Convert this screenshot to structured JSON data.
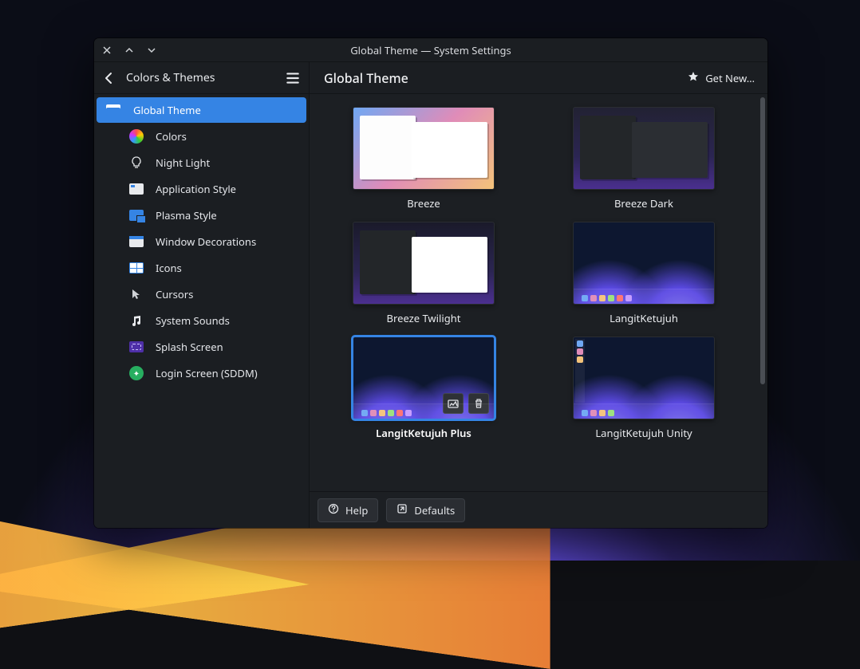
{
  "window": {
    "title": "Global Theme — System Settings"
  },
  "header": {
    "breadcrumb": "Colors & Themes",
    "page_title": "Global Theme",
    "get_new_label": "Get New…"
  },
  "sidebar": {
    "items": [
      {
        "id": "global-theme",
        "label": "Global Theme",
        "icon": "global",
        "active": true,
        "indent": false
      },
      {
        "id": "colors",
        "label": "Colors",
        "icon": "colors",
        "active": false,
        "indent": true
      },
      {
        "id": "night-light",
        "label": "Night Light",
        "icon": "bulb",
        "active": false,
        "indent": true
      },
      {
        "id": "application-style",
        "label": "Application Style",
        "icon": "appstyle",
        "active": false,
        "indent": true
      },
      {
        "id": "plasma-style",
        "label": "Plasma Style",
        "icon": "plasma",
        "active": false,
        "indent": true
      },
      {
        "id": "window-decorations",
        "label": "Window Decorations",
        "icon": "wdeco",
        "active": false,
        "indent": true
      },
      {
        "id": "icons",
        "label": "Icons",
        "icon": "icons",
        "active": false,
        "indent": true
      },
      {
        "id": "cursors",
        "label": "Cursors",
        "icon": "cursor",
        "active": false,
        "indent": true
      },
      {
        "id": "system-sounds",
        "label": "System Sounds",
        "icon": "note",
        "active": false,
        "indent": true
      },
      {
        "id": "splash-screen",
        "label": "Splash Screen",
        "icon": "splash",
        "active": false,
        "indent": true
      },
      {
        "id": "login-screen",
        "label": "Login Screen (SDDM)",
        "icon": "login",
        "active": false,
        "indent": true
      }
    ]
  },
  "themes": [
    {
      "id": "breeze",
      "label": "Breeze",
      "thumb": "breeze",
      "selected": false
    },
    {
      "id": "breeze-dark",
      "label": "Breeze Dark",
      "thumb": "breezedark",
      "selected": false
    },
    {
      "id": "breeze-twilight",
      "label": "Breeze Twilight",
      "thumb": "twilight",
      "selected": false
    },
    {
      "id": "langitketujuh",
      "label": "LangitKetujuh",
      "thumb": "lk",
      "selected": false
    },
    {
      "id": "lk-plus",
      "label": "LangitKetujuh Plus",
      "thumb": "lkplus",
      "selected": true
    },
    {
      "id": "lk-unity",
      "label": "LangitKetujuh Unity",
      "thumb": "lkunity",
      "selected": false
    }
  ],
  "footer": {
    "help_label": "Help",
    "defaults_label": "Defaults"
  },
  "colors": {
    "accent": "#3584e4",
    "window_bg": "#1b1e22",
    "text": "#e8eaed"
  }
}
